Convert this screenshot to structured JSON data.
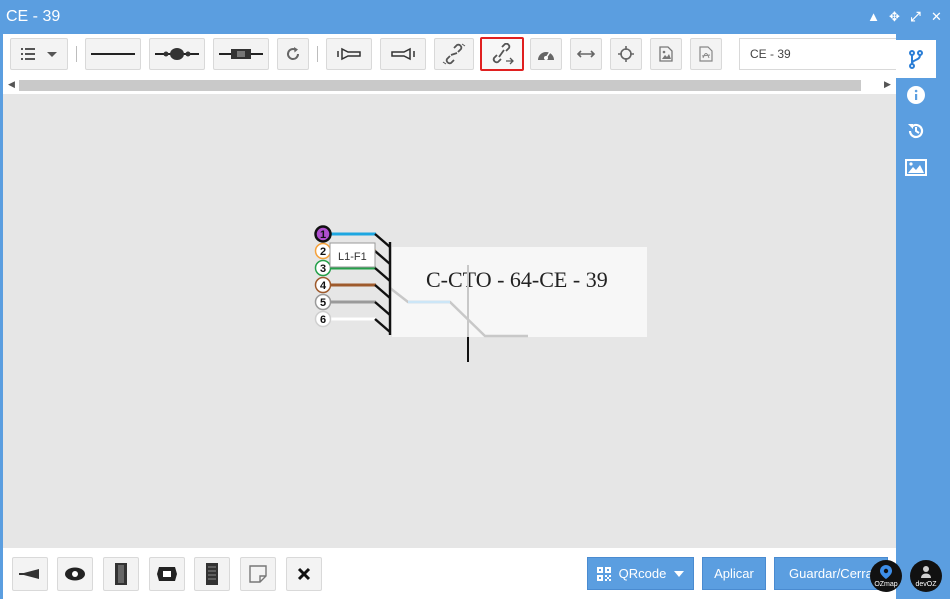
{
  "window": {
    "title": "CE - 39"
  },
  "toolbar": {
    "search_value": "CE - 39",
    "buttons": [
      "list-menu",
      "straight-cable",
      "splice-closure",
      "connector",
      "refresh",
      "flashlight-left",
      "flashlight-right",
      "unlink",
      "link-cables",
      "dashboard",
      "horizontal-arrows",
      "crosshair",
      "image",
      "pdf"
    ]
  },
  "canvas": {
    "box_label": "C-CTO - 64-CE - 39",
    "tooltip": "L1-F1",
    "fibers": [
      {
        "number": "1",
        "color": "#1ea7e1",
        "ring": "#b04fcf"
      },
      {
        "number": "2",
        "color": "#f5a23c",
        "ring": "#f5a23c"
      },
      {
        "number": "3",
        "color": "#25a04a",
        "ring": "#25a04a"
      },
      {
        "number": "4",
        "color": "#9e5a2c",
        "ring": "#9e5a2c"
      },
      {
        "number": "5",
        "color": "#9a9a9a",
        "ring": "#9a9a9a"
      },
      {
        "number": "6",
        "color": "#ffffff",
        "ring": "#cfcfcf"
      }
    ]
  },
  "bottom": {
    "qr_label": "QRcode",
    "apply_label": "Aplicar",
    "save_label": "Guardar/Cerrar",
    "logos": [
      "OZmap",
      "devOZ"
    ]
  },
  "colors": {
    "accent": "#5b9ee0",
    "highlight": "#e02020"
  }
}
